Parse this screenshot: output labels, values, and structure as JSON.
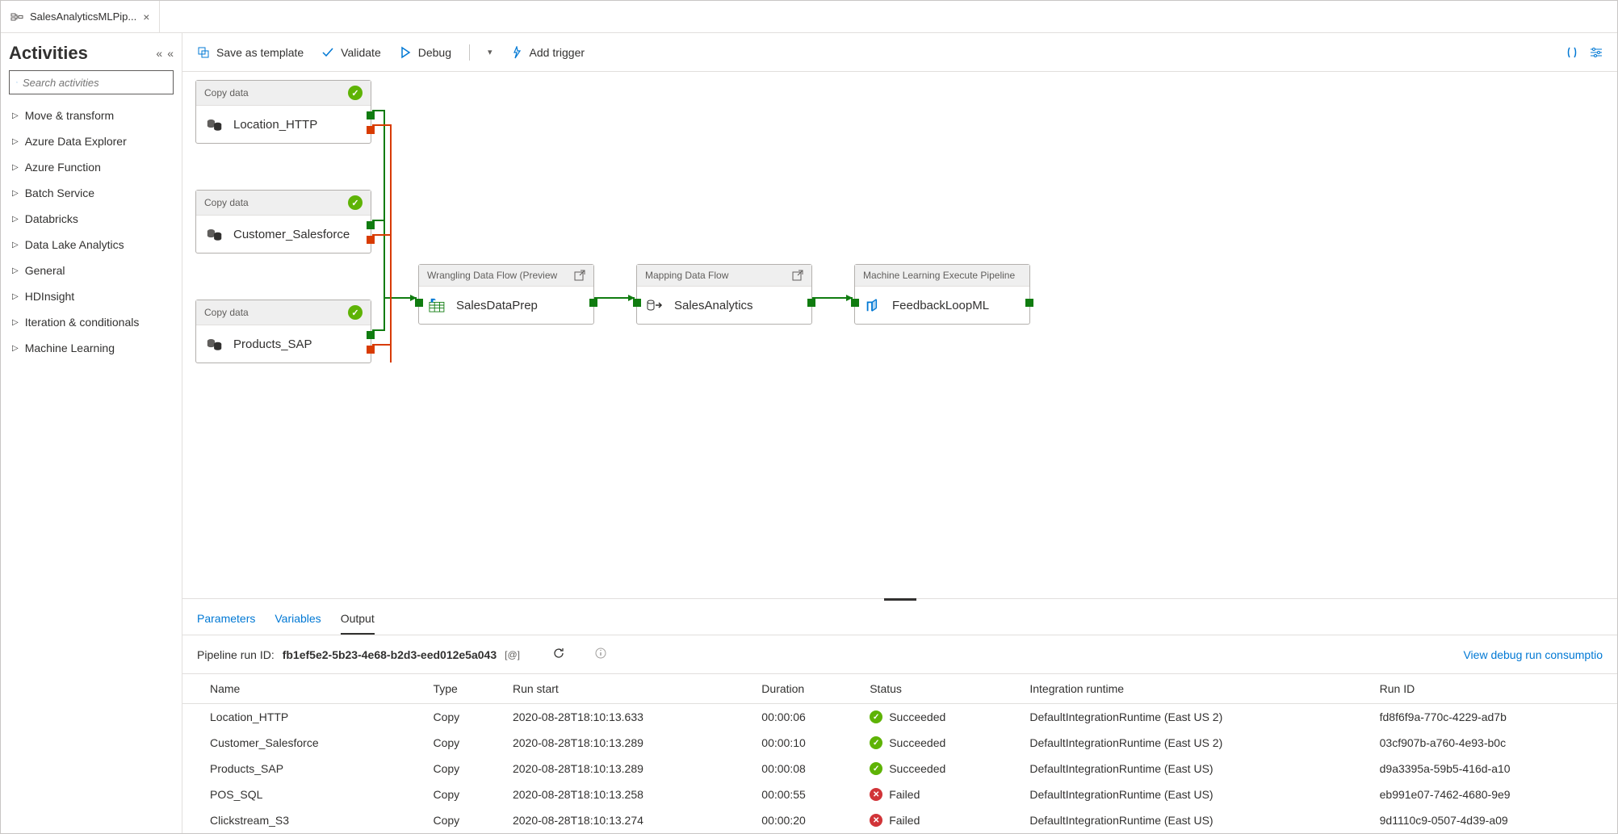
{
  "tab": {
    "title": "SalesAnalyticsMLPip..."
  },
  "sidebar": {
    "title": "Activities",
    "search_placeholder": "Search activities",
    "items": [
      "Move & transform",
      "Azure Data Explorer",
      "Azure Function",
      "Batch Service",
      "Databricks",
      "Data Lake Analytics",
      "General",
      "HDInsight",
      "Iteration & conditionals",
      "Machine Learning"
    ]
  },
  "toolbar": {
    "save": "Save as template",
    "validate": "Validate",
    "debug": "Debug",
    "trigger": "Add trigger"
  },
  "nodes": {
    "n0": {
      "type": "Copy data",
      "name": "Location_HTTP"
    },
    "n1": {
      "type": "Copy data",
      "name": "Customer_Salesforce"
    },
    "n2": {
      "type": "Copy data",
      "name": "Products_SAP"
    },
    "n3": {
      "type": "Wrangling Data Flow (Preview",
      "name": "SalesDataPrep"
    },
    "n4": {
      "type": "Mapping Data Flow",
      "name": "SalesAnalytics"
    },
    "n5": {
      "type": "Machine Learning Execute Pipeline",
      "name": "FeedbackLoopML"
    }
  },
  "output": {
    "tabs": {
      "params": "Parameters",
      "vars": "Variables",
      "out": "Output"
    },
    "run_label": "Pipeline run ID:",
    "run_id": "fb1ef5e2-5b23-4e68-b2d3-eed012e5a043",
    "consumption": "View debug run consumptio",
    "cols": {
      "name": "Name",
      "type": "Type",
      "start": "Run start",
      "dur": "Duration",
      "status": "Status",
      "ir": "Integration runtime",
      "rid": "Run ID"
    },
    "rows": [
      {
        "name": "Location_HTTP",
        "type": "Copy",
        "start": "2020-08-28T18:10:13.633",
        "dur": "00:00:06",
        "status": "Succeeded",
        "ok": true,
        "ir": "DefaultIntegrationRuntime (East US 2)",
        "rid": "fd8f6f9a-770c-4229-ad7b"
      },
      {
        "name": "Customer_Salesforce",
        "type": "Copy",
        "start": "2020-08-28T18:10:13.289",
        "dur": "00:00:10",
        "status": "Succeeded",
        "ok": true,
        "ir": "DefaultIntegrationRuntime (East US 2)",
        "rid": "03cf907b-a760-4e93-b0c"
      },
      {
        "name": "Products_SAP",
        "type": "Copy",
        "start": "2020-08-28T18:10:13.289",
        "dur": "00:00:08",
        "status": "Succeeded",
        "ok": true,
        "ir": "DefaultIntegrationRuntime (East US)",
        "rid": "d9a3395a-59b5-416d-a10"
      },
      {
        "name": "POS_SQL",
        "type": "Copy",
        "start": "2020-08-28T18:10:13.258",
        "dur": "00:00:55",
        "status": "Failed",
        "ok": false,
        "ir": "DefaultIntegrationRuntime (East US)",
        "rid": "eb991e07-7462-4680-9e9"
      },
      {
        "name": "Clickstream_S3",
        "type": "Copy",
        "start": "2020-08-28T18:10:13.274",
        "dur": "00:00:20",
        "status": "Failed",
        "ok": false,
        "ir": "DefaultIntegrationRuntime (East US)",
        "rid": "9d1110c9-0507-4d39-a09"
      }
    ]
  }
}
